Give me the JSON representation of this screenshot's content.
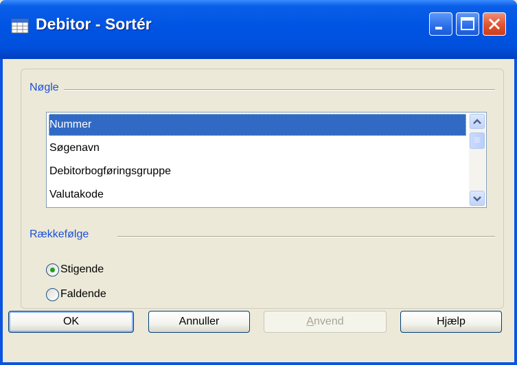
{
  "window": {
    "title": "Debitor - Sortér",
    "icon": "table-grid-icon",
    "controls": [
      "minimize-icon",
      "maximize-icon",
      "close-icon"
    ]
  },
  "key_section": {
    "label": "Nøgle",
    "items": [
      {
        "label": "Nummer",
        "selected": true
      },
      {
        "label": "Søgenavn",
        "selected": false
      },
      {
        "label": "Debitorbogføringsgruppe",
        "selected": false
      },
      {
        "label": "Valutakode",
        "selected": false
      }
    ]
  },
  "order_section": {
    "label": "Rækkefølge",
    "options": [
      {
        "label": "Stigende",
        "checked": true
      },
      {
        "label": "Faldende",
        "checked": false
      }
    ]
  },
  "buttons": {
    "ok": "OK",
    "cancel": "Annuller",
    "apply_first": "A",
    "apply_rest": "nvend",
    "help": "Hjælp"
  },
  "colors": {
    "title_bar": "#0054e3",
    "selection": "#316ac5",
    "section_label": "#1a4fd8",
    "radio_dot": "#21a121"
  }
}
